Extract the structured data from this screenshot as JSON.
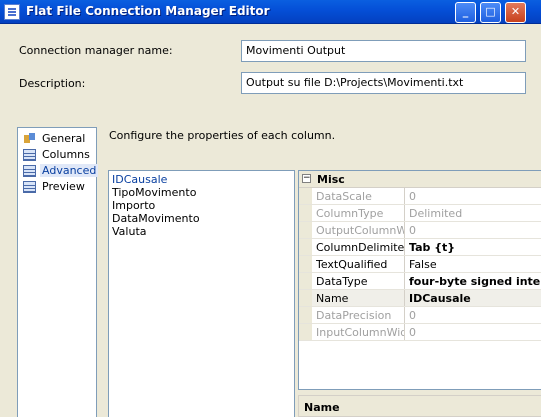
{
  "window": {
    "title": "Flat File Connection Manager Editor"
  },
  "form": {
    "name_label": "Connection manager name:",
    "name_value": "Movimenti Output",
    "desc_label": "Description:",
    "desc_value": "Output su file D:\\Projects\\Movimenti.txt"
  },
  "nav": {
    "items": [
      {
        "label": "General",
        "icon": "general-icon"
      },
      {
        "label": "Columns",
        "icon": "columns-icon"
      },
      {
        "label": "Advanced",
        "icon": "advanced-icon",
        "selected": true
      },
      {
        "label": "Preview",
        "icon": "preview-icon"
      }
    ]
  },
  "main": {
    "instruction": "Configure the properties of each column.",
    "columns": [
      "IDCausale",
      "TipoMovimento",
      "Importo",
      "DataMovimento",
      "Valuta"
    ],
    "selected_column": "IDCausale"
  },
  "grid": {
    "category": "Misc",
    "rows": [
      {
        "name": "DataScale",
        "value": "0",
        "disabled": true
      },
      {
        "name": "ColumnType",
        "value": "Delimited",
        "disabled": true
      },
      {
        "name": "OutputColumnWid",
        "value": "0",
        "disabled": true
      },
      {
        "name": "ColumnDelimiter",
        "value": "Tab {t}",
        "bold": true
      },
      {
        "name": "TextQualified",
        "value": "False"
      },
      {
        "name": "DataType",
        "value": "four-byte signed inte",
        "bold": true
      },
      {
        "name": "Name",
        "value": "IDCausale",
        "bold": true,
        "selected": true
      },
      {
        "name": "DataPrecision",
        "value": "0",
        "disabled": true
      },
      {
        "name": "InputColumnWidth",
        "value": "0",
        "disabled": true
      }
    ],
    "description_title": "Name"
  }
}
